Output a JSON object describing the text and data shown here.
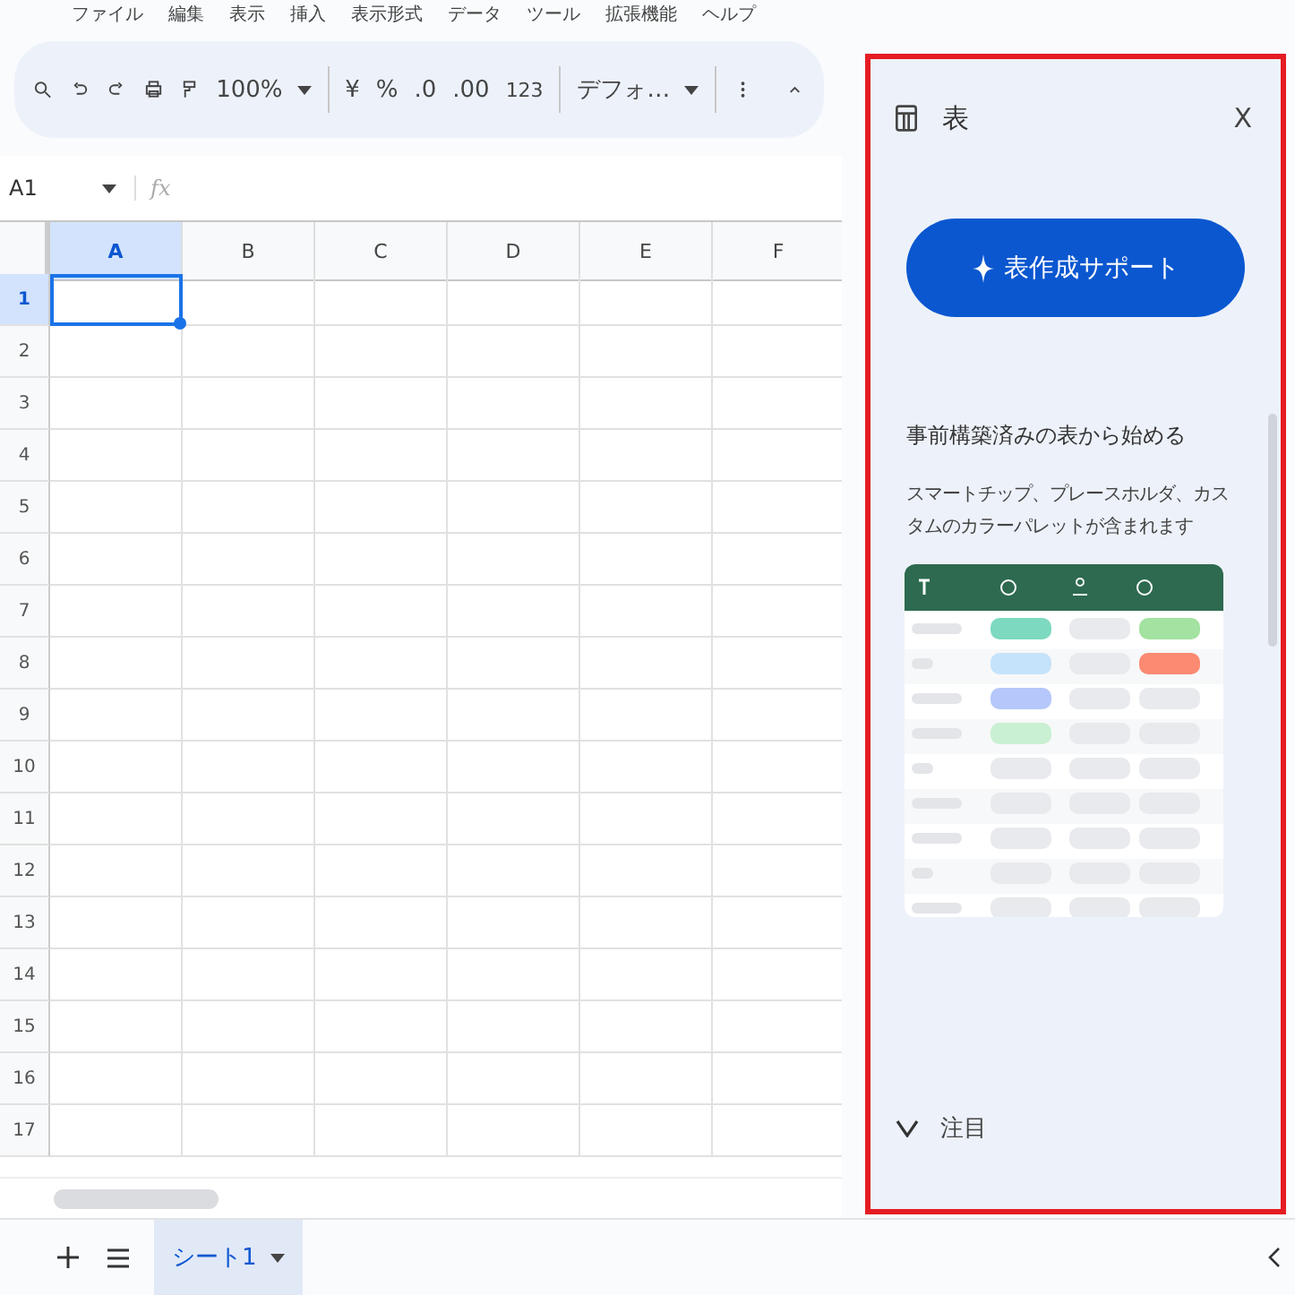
{
  "menu": [
    "ファイル",
    "編集",
    "表示",
    "挿入",
    "表示形式",
    "データ",
    "ツール",
    "拡張機能",
    "ヘルプ"
  ],
  "toolbar": {
    "zoom": "100%",
    "currency": "¥",
    "percent": "%",
    "decimal_decrease": ".0",
    "decimal_increase": ".00",
    "number_format": "123",
    "font": "デフォ…"
  },
  "name_box": "A1",
  "formula_icon": "fx",
  "columns": [
    {
      "label": "A",
      "selected": true
    },
    {
      "label": "B",
      "selected": false
    },
    {
      "label": "C",
      "selected": false
    },
    {
      "label": "D",
      "selected": false
    },
    {
      "label": "E",
      "selected": false
    },
    {
      "label": "F",
      "selected": false
    }
  ],
  "rows": [
    {
      "label": "1",
      "selected": true
    },
    {
      "label": "2",
      "selected": false
    },
    {
      "label": "3",
      "selected": false
    },
    {
      "label": "4",
      "selected": false
    },
    {
      "label": "5",
      "selected": false
    },
    {
      "label": "6",
      "selected": false
    },
    {
      "label": "7",
      "selected": false
    },
    {
      "label": "8",
      "selected": false
    },
    {
      "label": "9",
      "selected": false
    },
    {
      "label": "10",
      "selected": false
    },
    {
      "label": "11",
      "selected": false
    },
    {
      "label": "12",
      "selected": false
    },
    {
      "label": "13",
      "selected": false
    },
    {
      "label": "14",
      "selected": false
    },
    {
      "label": "15",
      "selected": false
    },
    {
      "label": "16",
      "selected": false
    },
    {
      "label": "17",
      "selected": false
    }
  ],
  "side_panel": {
    "title": "表",
    "close": "X",
    "assist_button": "表作成サポート",
    "heading": "事前構築済みの表から始める",
    "description": "スマートチップ、プレースホルダ、カスタムのカラーパレットが含まれます",
    "section": {
      "label": "注目",
      "expanded": false
    }
  },
  "sheets": [
    {
      "label": "シート1",
      "selected": true
    }
  ]
}
